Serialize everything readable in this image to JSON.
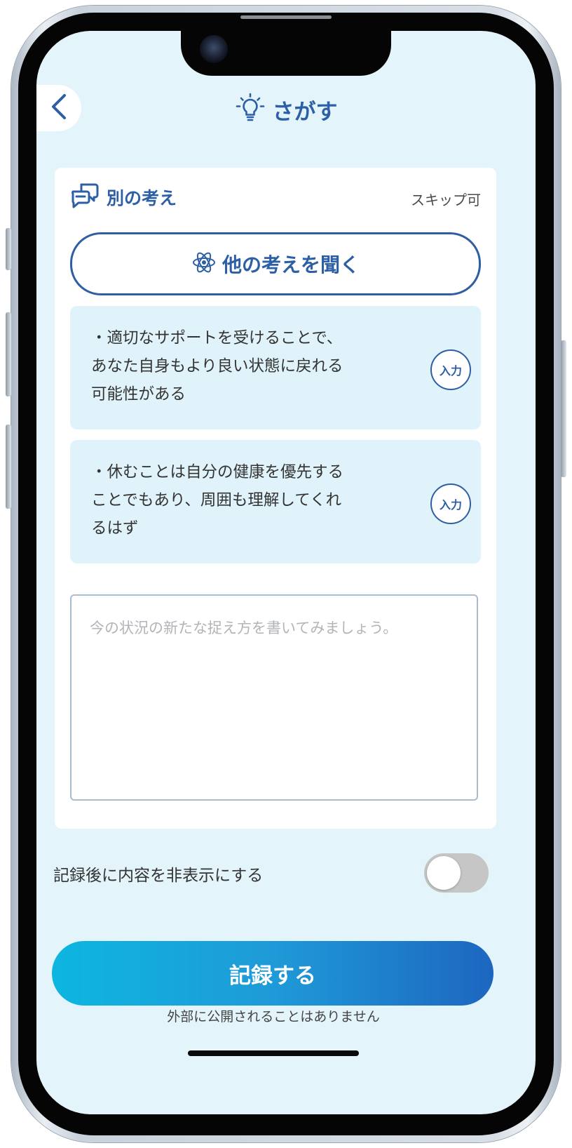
{
  "header": {
    "title": "さがす",
    "back_icon": "chevron-left-icon",
    "title_icon": "lightbulb-icon"
  },
  "section": {
    "title": "別の考え",
    "icon": "chat-bubbles-icon",
    "skip_label": "スキップ可"
  },
  "ask_button": {
    "label": "他の考えを聞く",
    "icon": "atom-icon"
  },
  "suggestions": [
    {
      "text": "・適切なサポートを受けることで、\nあなた自身もより良い状態に戻れる\n可能性がある",
      "action_label": "入力"
    },
    {
      "text": "・休むことは自分の健康を優先する\nことでもあり、周囲も理解してくれ\nるはず",
      "action_label": "入力"
    }
  ],
  "reframe_input": {
    "value": "",
    "placeholder": "今の状況の新たな捉え方を書いてみましょう。"
  },
  "hide_toggle": {
    "label": "記録後に内容を非表示にする",
    "on": false
  },
  "submit": {
    "label": "記録する",
    "note": "外部に公開されることはありません"
  },
  "colors": {
    "accent": "#2d5fa6",
    "screen_background": "#e3f4fb",
    "suggestion_background": "#e1f3fa",
    "button_gradient_start": "#0db6e0",
    "button_gradient_end": "#1d66c0",
    "toggle_off": "#c6c6c6"
  }
}
